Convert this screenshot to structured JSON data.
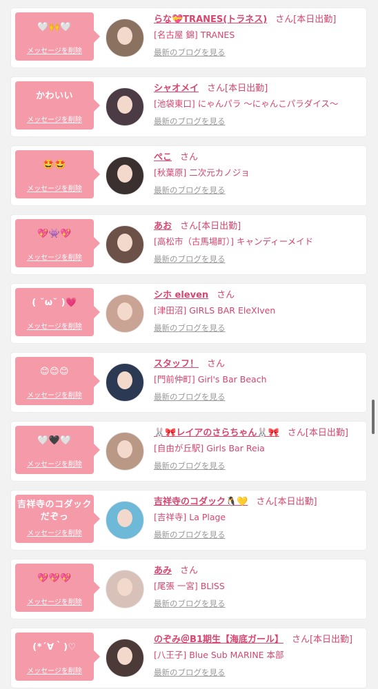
{
  "colors": {
    "accent": "#d6466f",
    "bubble": "#f49aa9",
    "muted": "#999999"
  },
  "cards": [
    {
      "message": "🤍🙌🤍",
      "delete_label": "メッセージを削除",
      "name": "らな💝TRANES(トラネス)",
      "honorific": "さん[本日出勤]",
      "shop": "[名古屋 錦] TRANES",
      "blog_label": "最新のブログを見る",
      "avatar_color": "#8a7160"
    },
    {
      "message": "かわいい",
      "delete_label": "メッセージを削除",
      "name": "シャオメイ",
      "honorific": "さん[本日出勤]",
      "shop": "[池袋東口] にゃんパラ 〜にゃんこパラダイス〜",
      "blog_label": "最新のブログを見る",
      "avatar_color": "#4a3b45"
    },
    {
      "message": "🤩🤩",
      "delete_label": "メッセージを削除",
      "name": "ぺこ",
      "honorific": "さん",
      "shop": "[秋葉原] 二次元カノジョ",
      "blog_label": "最新のブログを見る",
      "avatar_color": "#3b3030"
    },
    {
      "message": "💖👾💖",
      "delete_label": "メッセージを削除",
      "name": "あお",
      "honorific": "さん[本日出勤]",
      "shop": "[高松市（古馬場町）] キャンディーメイド",
      "blog_label": "最新のブログを見る",
      "avatar_color": "#6b5148"
    },
    {
      "message": "( ˘ω˘ )💗",
      "delete_label": "メッセージを削除",
      "name": "シホ eleven",
      "honorific": "さん",
      "shop": "[津田沼] GIRLS BAR EleXIven",
      "blog_label": "最新のブログを見る",
      "avatar_color": "#c9a394"
    },
    {
      "message": "😊😊😊",
      "delete_label": "メッセージを削除",
      "name": "スタッフ！",
      "honorific": "さん",
      "shop": "[門前仲町] Girl's Bar Beach",
      "blog_label": "最新のブログを見る",
      "avatar_color": "#2b3a52"
    },
    {
      "message": "🤍🖤🤍",
      "delete_label": "メッセージを削除",
      "name": "🐰🎀レイアのさらちゃん🐰🎀",
      "honorific": "さん[本日出勤]",
      "shop": "[自由が丘駅] Girls Bar Reia",
      "blog_label": "最新のブログを見る",
      "avatar_color": "#b99986"
    },
    {
      "message": "吉祥寺のコダック\nだぞっ",
      "delete_label": "メッセージを削除",
      "name": "吉祥寺のコダック🐧💛",
      "honorific": "さん[本日出勤]",
      "shop": "[吉祥寺] La Plage",
      "blog_label": "最新のブログを見る",
      "avatar_color": "#6fb9d8"
    },
    {
      "message": "💖💖💖",
      "delete_label": "メッセージを削除",
      "name": "あみ",
      "honorific": "さん",
      "shop": "[尾張 一宮] BLISS",
      "blog_label": "最新のブログを見る",
      "avatar_color": "#d8c1b8"
    },
    {
      "message": "(*´∀｀)♡",
      "delete_label": "メッセージを削除",
      "name": "のぞみ＠B1期生【海底ガール】",
      "honorific": "さん[本日出勤]",
      "shop": "[八王子] Blue Sub MARINE 本部",
      "blog_label": "最新のブログを見る",
      "avatar_color": "#4b3a38"
    }
  ]
}
